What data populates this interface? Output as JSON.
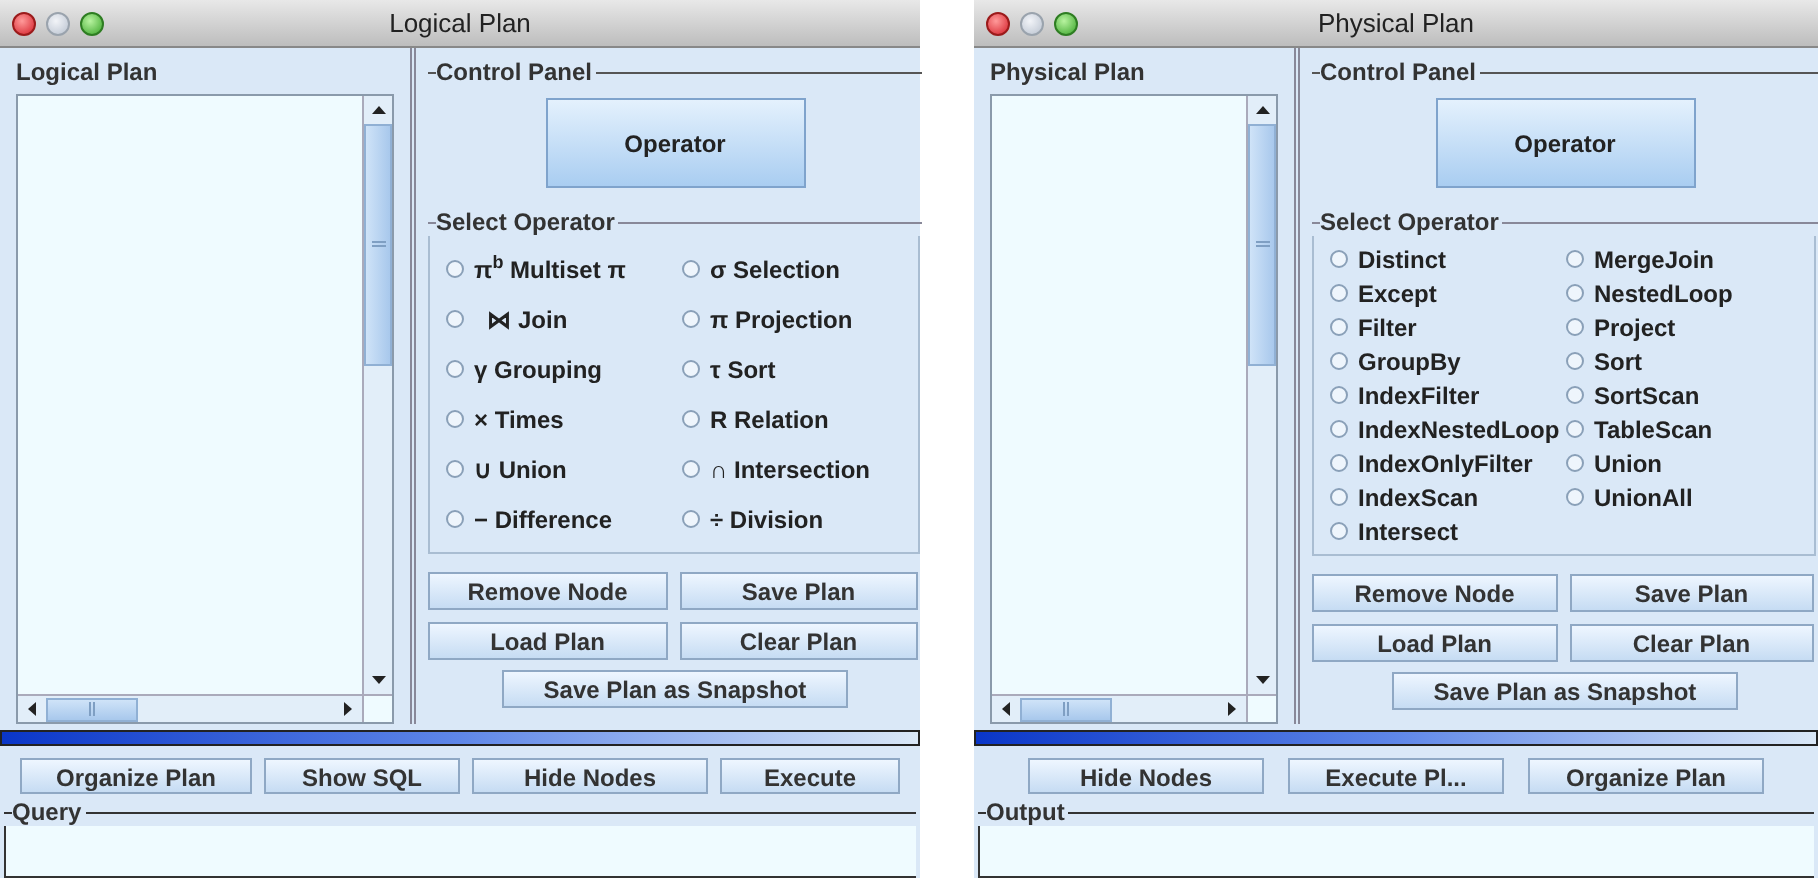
{
  "windows": [
    {
      "kind": "logical",
      "title": "Logical Plan",
      "plan_panel": {
        "title": "Logical Plan"
      },
      "control_panel": {
        "title": "Control Panel",
        "operator_button": "Operator",
        "select_title": "Select Operator",
        "operator_columns": [
          [
            {
              "label": "π$^{b}$ Multiset π",
              "selected": false
            },
            {
              "label": "  ⋈ Join",
              "selected": false
            },
            {
              "label": "γ Grouping",
              "selected": false
            },
            {
              "label": "× Times",
              "selected": false
            },
            {
              "label": "∪ Union",
              "selected": false
            },
            {
              "label": "− Difference",
              "selected": false
            }
          ],
          [
            {
              "label": "σ Selection",
              "selected": false
            },
            {
              "label": "π Projection",
              "selected": false
            },
            {
              "label": "τ Sort",
              "selected": false
            },
            {
              "label": "R Relation",
              "selected": false
            },
            {
              "label": "∩ Intersection",
              "selected": false
            },
            {
              "label": "÷ Division",
              "selected": false
            }
          ]
        ],
        "action_buttons": [
          "Remove Node",
          "Save Plan",
          "Load Plan",
          "Clear Plan"
        ],
        "snapshot_button": "Save Plan as Snapshot"
      },
      "bottom_buttons": [
        "Organize Plan",
        "Show SQL",
        "Hide Nodes",
        "Execute"
      ],
      "text_panel": {
        "title": "Query"
      }
    },
    {
      "kind": "physical",
      "title": "Physical Plan",
      "plan_panel": {
        "title": "Physical Plan"
      },
      "control_panel": {
        "title": "Control Panel",
        "operator_button": "Operator",
        "select_title": "Select Operator",
        "operator_columns": [
          [
            {
              "label": "Distinct",
              "selected": false
            },
            {
              "label": "Except",
              "selected": false
            },
            {
              "label": "Filter",
              "selected": false
            },
            {
              "label": "GroupBy",
              "selected": false
            },
            {
              "label": "IndexFilter",
              "selected": false
            },
            {
              "label": "IndexNestedLoop",
              "selected": false
            },
            {
              "label": "IndexOnlyFilter",
              "selected": false
            },
            {
              "label": "IndexScan",
              "selected": false
            },
            {
              "label": "Intersect",
              "selected": false
            }
          ],
          [
            {
              "label": "MergeJoin",
              "selected": false
            },
            {
              "label": "NestedLoop",
              "selected": false
            },
            {
              "label": "Project",
              "selected": false
            },
            {
              "label": "Sort",
              "selected": false
            },
            {
              "label": "SortScan",
              "selected": false
            },
            {
              "label": "TableScan",
              "selected": false
            },
            {
              "label": "Union",
              "selected": false
            },
            {
              "label": "UnionAll",
              "selected": false
            }
          ]
        ],
        "action_buttons": [
          "Remove Node",
          "Save Plan",
          "Load Plan",
          "Clear Plan"
        ],
        "snapshot_button": "Save Plan as Snapshot"
      },
      "bottom_buttons": [
        "Hide Nodes",
        "Execute Pl...",
        "Organize Plan"
      ],
      "text_panel": {
        "title": "Output"
      }
    }
  ]
}
